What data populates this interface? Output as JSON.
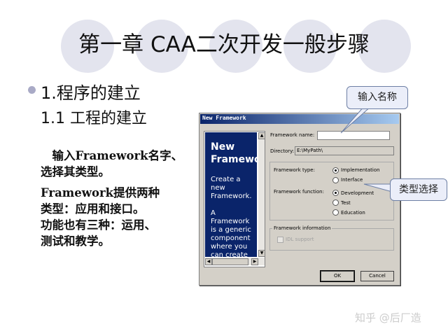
{
  "slide": {
    "title": "第一章  CAA二次开发一般步骤",
    "heading": "1.程序的建立",
    "subheading": "1.1 工程的建立",
    "paragraph1": [
      "　输入Framework名字、",
      "选择其类型。"
    ],
    "paragraph2": [
      " Framework提供两种",
      "类型：应用和接口。",
      "功能也有三种：运用、",
      "测试和教学。"
    ],
    "watermark": "知乎 @后厂造"
  },
  "callouts": {
    "name_input": "输入名称",
    "type_select": "类型选择"
  },
  "dialog": {
    "title": "New Framework",
    "side_panel": {
      "title": "New\nFramewo",
      "body": "Create a\nnew\nFramework.\n\nA\nFramework\nis a generic\ncomponent\nwhere you\ncan create"
    },
    "framework_name_label": "Framework name:",
    "framework_name_value": "",
    "directory_label": "Directory:",
    "directory_value": "E:\\MyPath\\",
    "framework_type_label": "Framework type:",
    "framework_type_options": [
      "Implementation",
      "Interface"
    ],
    "framework_type_selected": "Implementation",
    "framework_function_label": "Framework function:",
    "framework_function_options": [
      "Development",
      "Test",
      "Education"
    ],
    "framework_function_selected": "Development",
    "framework_information_label": "Framework information",
    "idl_support_label": "IDL support",
    "idl_support_checked": false,
    "ok_label": "OK",
    "cancel_label": "Cancel"
  },
  "colors": {
    "title_bar_start": "#0a246a",
    "title_bar_end": "#a6caf0",
    "side_panel_bg": "#0a246a",
    "callout_bg": "#ebeef9",
    "decor_circles": "#e3e4ee"
  }
}
